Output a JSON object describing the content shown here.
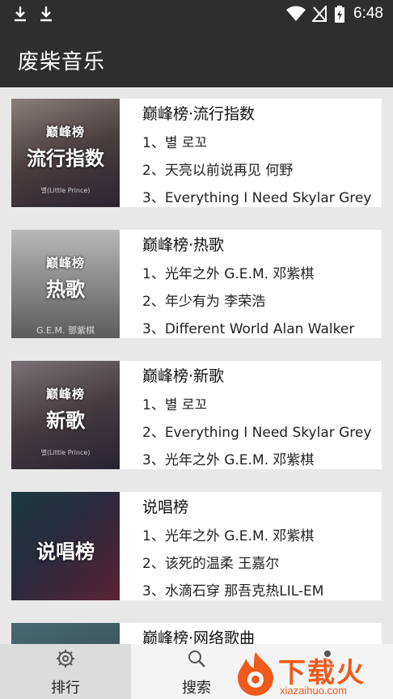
{
  "status_bar": {
    "time": "6:48"
  },
  "app": {
    "title": "废柴音乐"
  },
  "charts": [
    {
      "title": "巅峰榜·流行指数",
      "cover_label": "流行指数",
      "cover_badge": "巅峰榜",
      "cover_text": "별(Little Prince)",
      "songs": [
        "1、별 로꼬",
        "2、天亮以前说再见 何野",
        "3、Everything I Need Skylar Grey"
      ]
    },
    {
      "title": "巅峰榜·热歌",
      "cover_label": "热歌",
      "cover_badge": "巅峰榜",
      "cover_text": "G.E.M. 鄧紫棋",
      "songs": [
        "1、光年之外 G.E.M. 邓紫棋",
        "2、年少有为 李荣浩",
        "3、Different World Alan Walker"
      ]
    },
    {
      "title": "巅峰榜·新歌",
      "cover_label": "新歌",
      "cover_badge": "巅峰榜",
      "cover_text": "별(Little Prince)",
      "songs": [
        "1、별 로꼬",
        "2、Everything I Need Skylar Grey",
        "3、光年之外 G.E.M. 邓紫棋"
      ]
    },
    {
      "title": "说唱榜",
      "cover_label": "说唱榜",
      "cover_badge": "",
      "cover_text": "",
      "songs": [
        "1、光年之外 G.E.M. 邓紫棋",
        "2、该死的温柔 王嘉尔",
        "3、水滴石穿 那吾克热LIL-EM"
      ]
    },
    {
      "title": "巅峰榜·网络歌曲",
      "cover_label": "",
      "cover_badge": "",
      "cover_text": "",
      "songs": []
    }
  ],
  "nav": {
    "rank": "排行",
    "search": "搜索"
  },
  "watermark": {
    "text": "下载火",
    "url": "xiazaihuo.com"
  },
  "colors": {
    "bar": "#2e2e2e",
    "watermark": "#f05a1a"
  }
}
